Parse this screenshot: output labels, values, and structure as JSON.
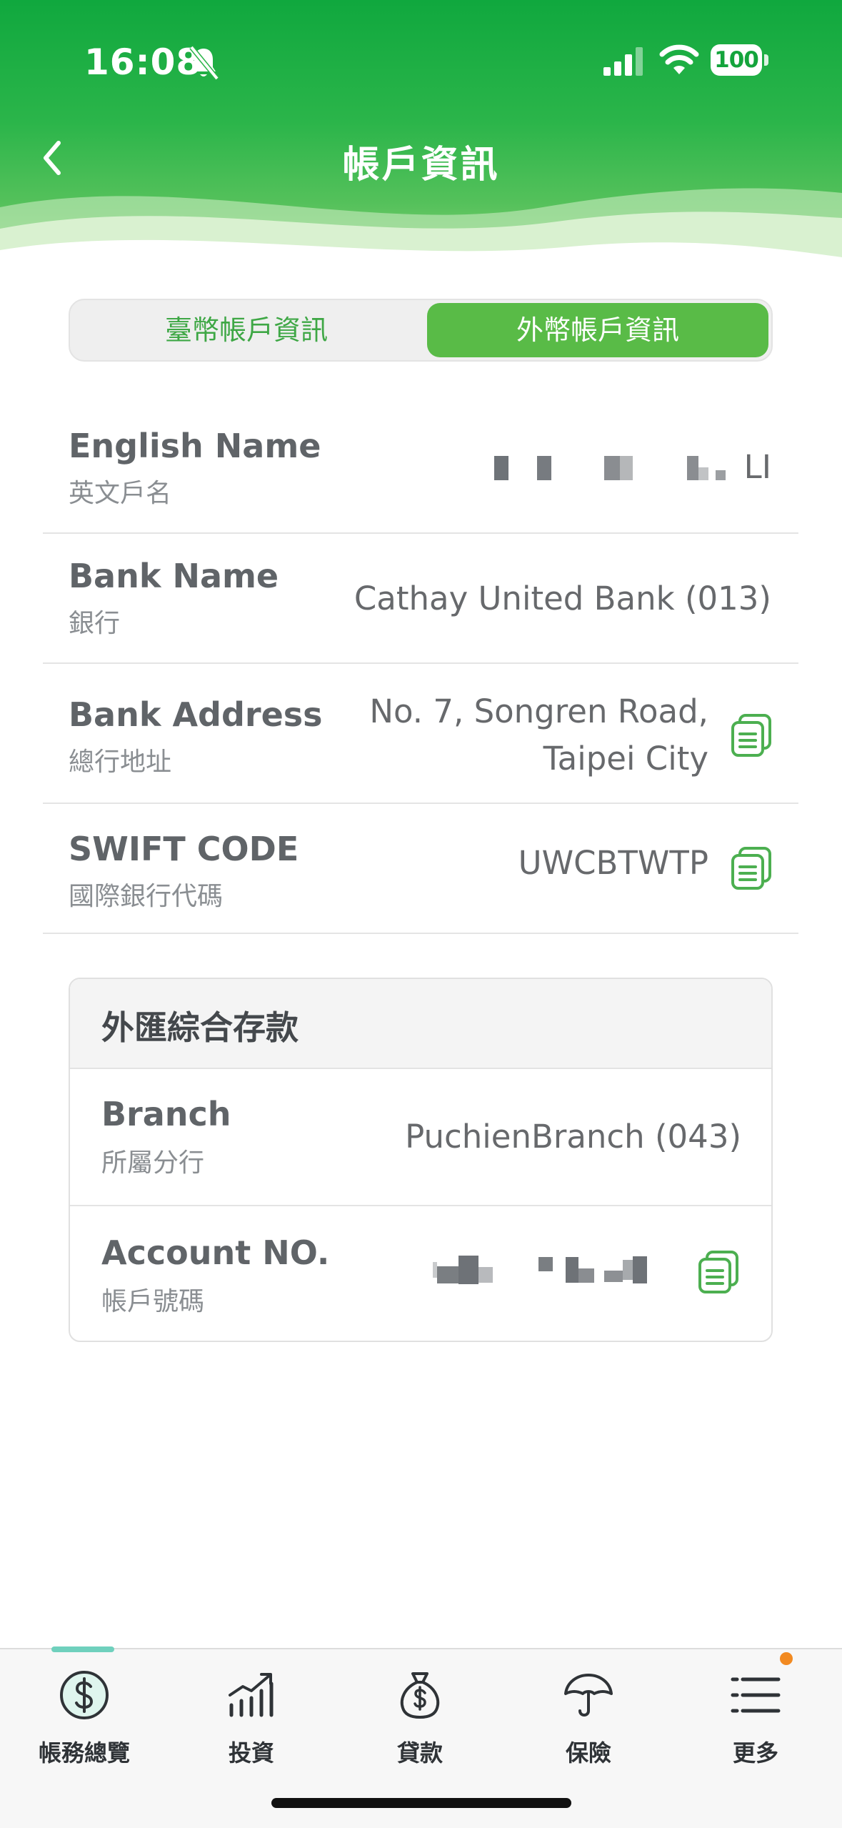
{
  "status_bar": {
    "time": "16:08",
    "battery": "100"
  },
  "header": {
    "title": "帳戶資訊",
    "back_icon": "chevron-left-icon"
  },
  "tabs": [
    {
      "label": "臺幣帳戶資訊",
      "selected": false
    },
    {
      "label": "外幣帳戶資訊",
      "selected": true
    }
  ],
  "info_rows": {
    "english_name": {
      "label_en": "English Name",
      "label_zh": "英文戶名",
      "value_suffix": "LI"
    },
    "bank_name": {
      "label_en": "Bank Name",
      "label_zh": "銀行",
      "value": "Cathay United Bank (013)"
    },
    "bank_address": {
      "label_en": "Bank Address",
      "label_zh": "總行地址",
      "value_line1": "No. 7, Songren Road,",
      "value_line2": "Taipei City"
    },
    "swift_code": {
      "label_en": "SWIFT CODE",
      "label_zh": "國際銀行代碼",
      "value": "UWCBTWTP"
    }
  },
  "account_card": {
    "title": "外匯綜合存款",
    "branch": {
      "label_en": "Branch",
      "label_zh": "所屬分行",
      "value": "PuchienBranch (043)"
    },
    "account_no": {
      "label_en": "Account NO.",
      "label_zh": "帳戶號碼"
    }
  },
  "bottom_nav": [
    {
      "label": "帳務總覽",
      "icon": "dollar-circle-icon",
      "active": true
    },
    {
      "label": "投資",
      "icon": "chart-growth-icon"
    },
    {
      "label": "貸款",
      "icon": "money-bag-icon"
    },
    {
      "label": "保險",
      "icon": "umbrella-icon"
    },
    {
      "label": "更多",
      "icon": "menu-icon",
      "has_badge": true
    }
  ],
  "colors": {
    "brand_green": "#10a83e",
    "tab_active": "#59bb47",
    "accent_teal": "#6fd0bd",
    "badge_orange": "#f28a21"
  }
}
